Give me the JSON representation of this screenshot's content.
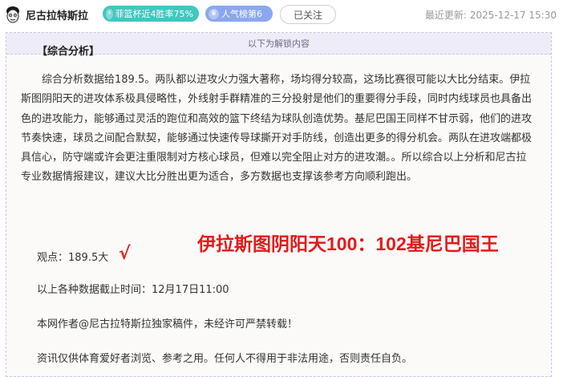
{
  "header": {
    "author": "尼古拉特斯拉",
    "badge_win": "菲篮杯近4胜率75%",
    "badge_pop": "人气榜第6",
    "follow_label": "已关注",
    "update_label": "最近更新:",
    "update_time": "2025-12-17 15:30"
  },
  "box": {
    "unlock_label": "以下为解锁内容"
  },
  "article": {
    "heading": "【综合分析】",
    "paragraph": "综合分析数据给189.5。两队都以进攻火力强大著称，场均得分较高，这场比赛很可能以大比分结束。伊拉斯图阴阳天的进攻体系极具侵略性，外线射手群精准的三分投射是他们的重要得分手段，同时内线球员也具备出色的进攻能力，能够通过灵活的跑位和高效的篮下终结为球队创造优势。基尼巴国王同样不甘示弱，他们的进攻节奏快速，球员之间配合默契，能够通过快速传导球撕开对手防线，创造出更多的得分机会。两队在进攻端都极具信心，防守端或许会更注重限制对方核心球员，但难以完全阻止对方的进攻潮。。所以综合以上分析和尼古拉专业数据情报建议，建议大比分胜出更为适合，多方数据也支撑该参考方向顺利跑出。",
    "viewpoint": "观点：189.5大",
    "check_mark": "√",
    "cutoff": "以上各种数据截止时间：12月17日11:00",
    "copyright": "本网作者@尼古拉特斯拉独家稿件，未经许可严禁转载！",
    "disclaimer": "资讯仅供体育爱好者浏览、参考之用。任何人不得用于非法用途，否则责任自负。"
  },
  "overlay": {
    "score_text": "伊拉斯图阴阳天100：102基尼巴国王"
  },
  "colors": {
    "badge_win": "#3fc7c0",
    "badge_pop": "#8ba7ef",
    "overlay_red": "#e11b1b",
    "box_border": "#c9c3e6"
  },
  "icons": {
    "avatar": "cartoon-face-avatar",
    "badge_win": "lightning-icon",
    "badge_pop": "crown-icon"
  }
}
